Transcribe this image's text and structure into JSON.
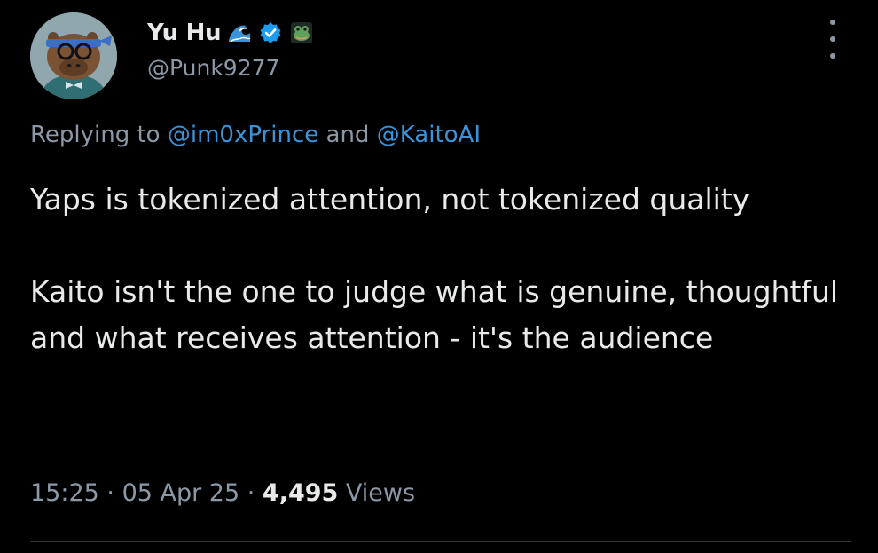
{
  "author": {
    "display_name": "Yu Hu",
    "handle": "@Punk9277",
    "name_icons": [
      "wave-icon",
      "verified-badge-icon",
      "frog-emoji-icon"
    ]
  },
  "reply": {
    "prefix": "Replying to ",
    "mention_1": "@im0xPrince",
    "conjunction": " and ",
    "mention_2": "@KaitoAI"
  },
  "tweet": {
    "paragraph_1": "Yaps is tokenized attention, not tokenized quality",
    "paragraph_2": "Kaito isn't the one to judge what is genuine, thoughtful and what receives attention - it's the audience"
  },
  "meta": {
    "time": "15:25",
    "separator": " · ",
    "date": "05 Apr 25",
    "views_count": "4,495",
    "views_label": " Views"
  },
  "colors": {
    "background": "#000000",
    "text": "#e7e9ea",
    "secondary": "#8b98a5",
    "link": "#3b94d9",
    "verified": "#1d9bf0"
  }
}
